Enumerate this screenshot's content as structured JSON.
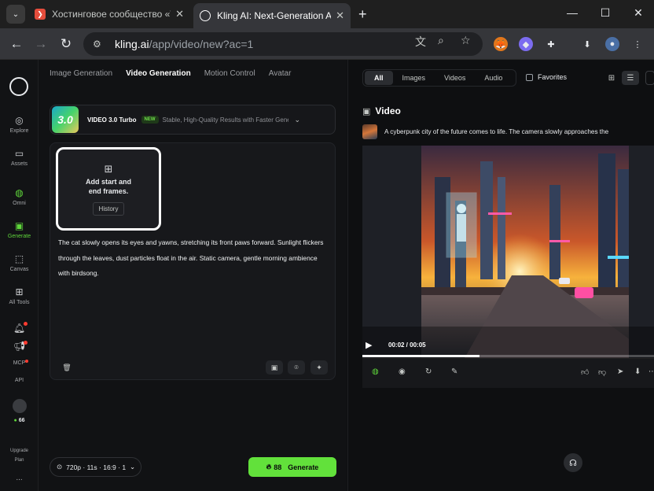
{
  "browser": {
    "tabs": [
      {
        "title": "Хостинговое сообщество «Tim",
        "active": false,
        "favicon_color": "#e54d3c"
      },
      {
        "title": "Kling AI: Next-Generation AI Cr",
        "active": true,
        "favicon_color": "#35363a"
      }
    ],
    "address": {
      "host": "kling.ai",
      "path": "/app/video/new?ac=1"
    }
  },
  "rail": {
    "items": [
      {
        "label": "Explore",
        "icon": "compass-icon"
      },
      {
        "label": "Assets",
        "icon": "folder-icon"
      },
      {
        "label": "Omni",
        "icon": "omni-icon"
      },
      {
        "label": "Generate",
        "icon": "generate-icon",
        "active": true
      },
      {
        "label": "Canvas",
        "icon": "canvas-icon"
      },
      {
        "label": "All Tools",
        "icon": "grid-icon"
      },
      {
        "label": "MCP",
        "icon": "mcp-icon"
      },
      {
        "label": "API",
        "icon": "api-icon"
      }
    ],
    "credits": "66",
    "upgrade_top": "Upgrade",
    "upgrade_bottom": "Plan",
    "more": "..."
  },
  "left": {
    "modes": [
      "Image Generation",
      "Video Generation",
      "Motion Control",
      "Avatar"
    ],
    "active_mode": "Video Generation",
    "model": {
      "thumb": "3.0",
      "name": "VIDEO 3.0 Turbo",
      "badge": "NEW",
      "description": "Stable, High-Quality Results with Faster Gener..."
    },
    "frames": {
      "title_line1": "Add start and",
      "title_line2": "end frames.",
      "history": "History"
    },
    "prompt": "The cat slowly opens its eyes and yawns, stretching its front paws forward. Sunlight flickers through the leaves, dust particles float in the air. Static camera, gentle morning ambience with birdsong.",
    "settings": "720p · 11s · 16:9 · 1",
    "generate": {
      "credits": "88",
      "label": "Generate"
    }
  },
  "right": {
    "filters": [
      "All",
      "Images",
      "Videos",
      "Audio"
    ],
    "active_filter": "All",
    "favorites": "Favorites",
    "section_title": "Video",
    "video_prompt": "A cyberpunk city of the future comes to life. The camera slowly approaches the",
    "time": "00:02 / 00:05",
    "progress": 0.4
  }
}
